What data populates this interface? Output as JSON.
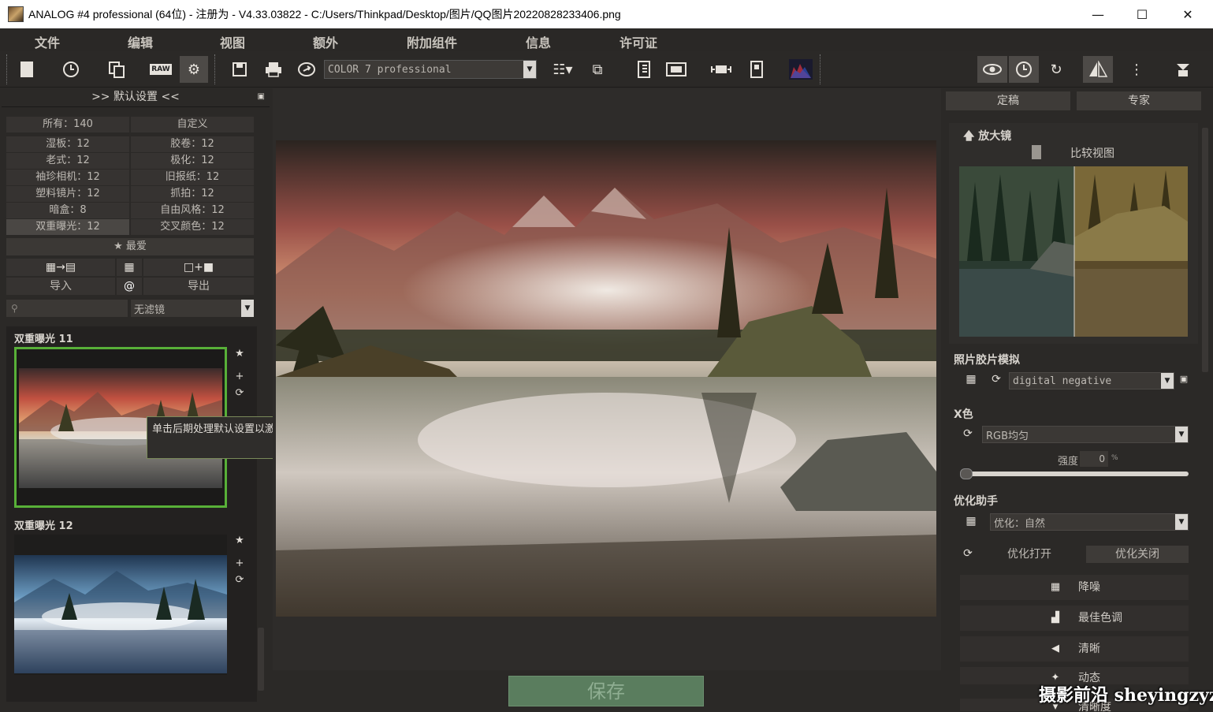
{
  "window": {
    "title": "ANALOG #4 professional (64位) - 注册为 - V4.33.03822 - C:/Users/Thinkpad/Desktop/图片/QQ图片20220828233406.png",
    "minimize": "—",
    "maximize": "☐",
    "close": "✕"
  },
  "menu": {
    "items": [
      "文件",
      "编辑",
      "视图",
      "额外",
      "附加组件",
      "信息",
      "许可证"
    ]
  },
  "toolbar": {
    "preset_value": "COLOR 7 professional",
    "raw_label": "RAW"
  },
  "left_panel": {
    "header": ">> 默认设置 <<",
    "categories": [
      [
        "所有：140",
        "自定义"
      ],
      [
        "湿板：12",
        "胶卷：12"
      ],
      [
        "老式：12",
        "极化：12"
      ],
      [
        "袖珍相机：12",
        "旧报纸：12"
      ],
      [
        "塑料镜片：12",
        "抓拍：12"
      ],
      [
        "暗盒：8",
        "自由风格：12"
      ],
      [
        "双重曝光：12",
        "交叉颜色：12"
      ]
    ],
    "favorites": "最爱",
    "import_label": "导入",
    "at_label": "@",
    "export_label": "导出",
    "filter_value": "无滤镜",
    "thumbs": [
      {
        "title": "双重曝光  11"
      },
      {
        "title": "双重曝光  12"
      }
    ],
    "tooltip": "单击后期处理默认设置以激活它"
  },
  "center": {
    "save_label": "保存"
  },
  "right_panel": {
    "tabs": [
      "定稿",
      "专家"
    ],
    "magnifier": {
      "title": "放大镜",
      "compare_label": "比较视图"
    },
    "film": {
      "title": "照片胶片模拟",
      "value": "digital negative"
    },
    "color": {
      "title": "X色",
      "value": "RGB均匀",
      "strength_label": "强度",
      "strength_value": "0",
      "unit": "%",
      "strength_fraction": 0
    },
    "optimize": {
      "title": "优化助手",
      "value": "优化：自然",
      "on_label": "优化打开",
      "off_label": "优化关闭"
    },
    "tools": [
      "降噪",
      "最佳色调",
      "清晰",
      "动态",
      "清晰度"
    ]
  },
  "watermark": "摄影前沿 sheyingzyz.com",
  "colors": {
    "accent_green": "#58b038",
    "save_bg": "#5a7d5e"
  }
}
